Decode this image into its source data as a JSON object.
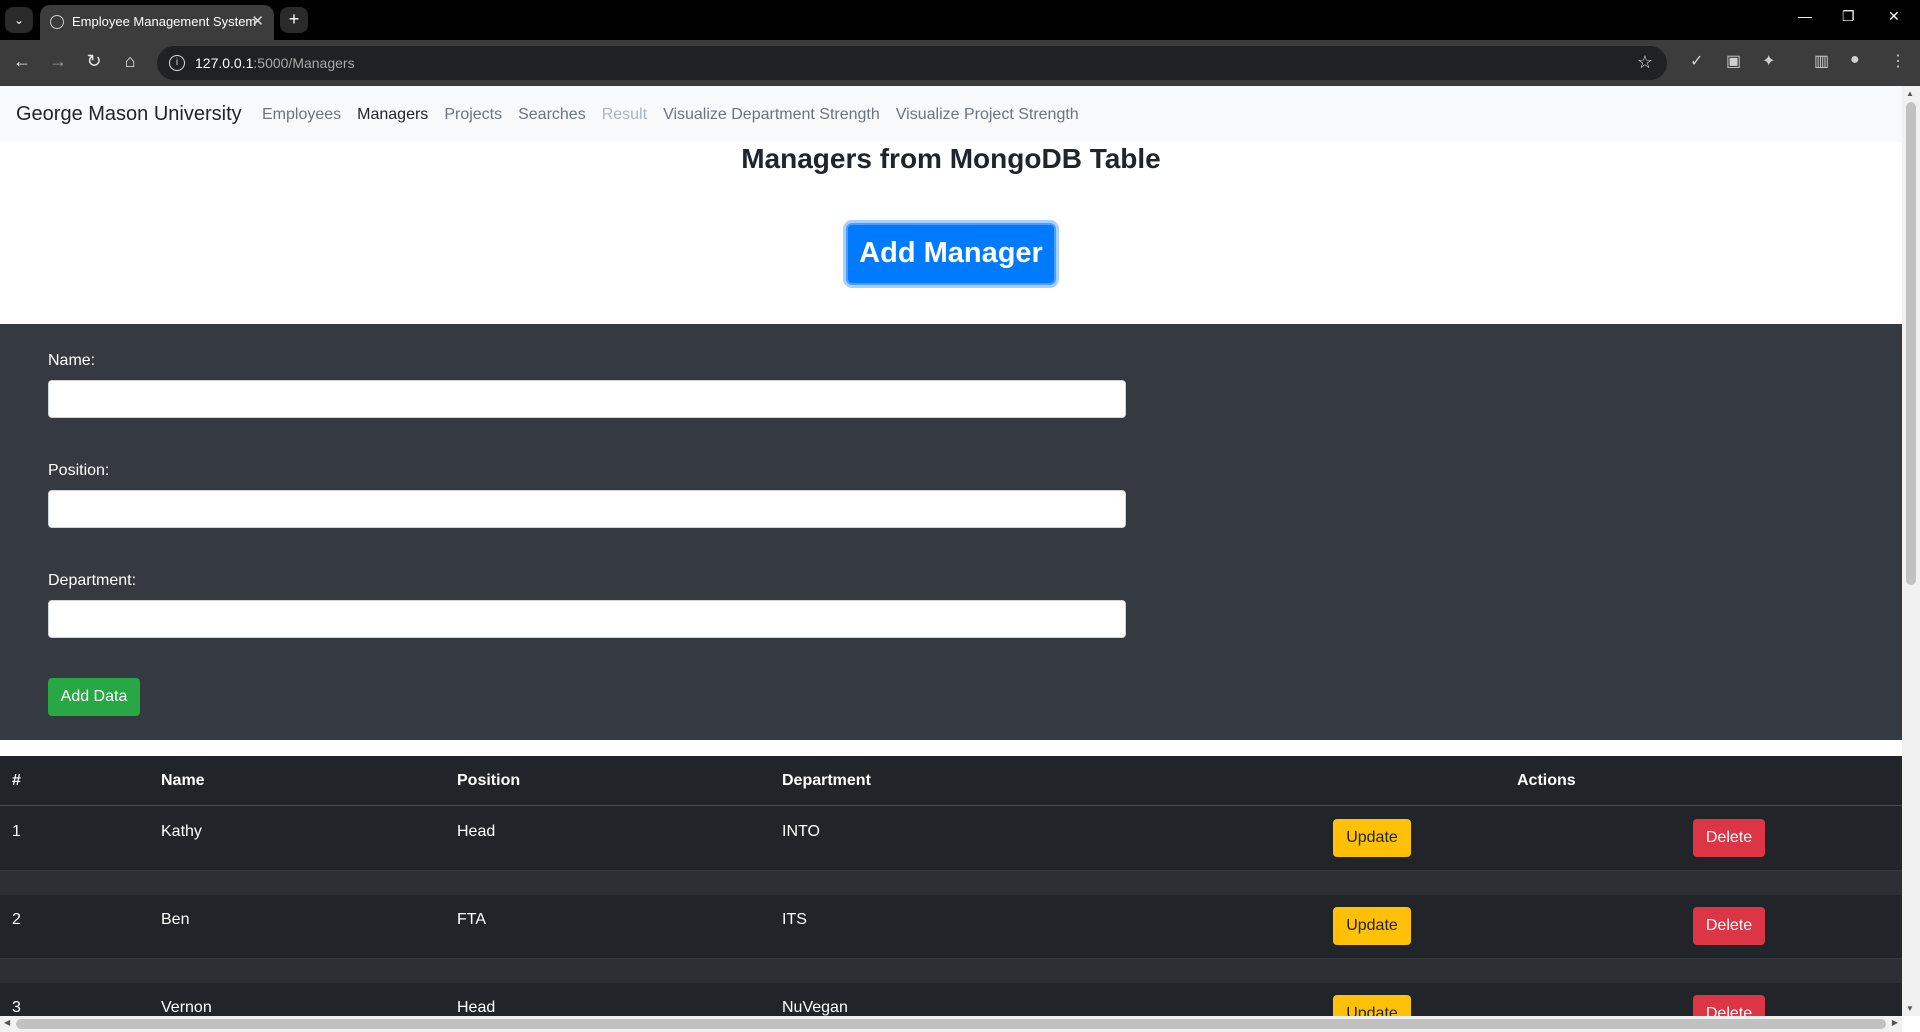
{
  "browser": {
    "tab_title": "Employee Management System",
    "url_host": "127.0.0.1",
    "url_rest": ":5000/Managers"
  },
  "navbar": {
    "brand": "George Mason University",
    "links": [
      {
        "label": "Employees",
        "state": "normal"
      },
      {
        "label": "Managers",
        "state": "active"
      },
      {
        "label": "Projects",
        "state": "normal"
      },
      {
        "label": "Searches",
        "state": "normal"
      },
      {
        "label": "Result",
        "state": "disabled"
      },
      {
        "label": "Visualize Department Strength",
        "state": "normal"
      },
      {
        "label": "Visualize Project Strength",
        "state": "normal"
      }
    ]
  },
  "main": {
    "heading": "Managers from MongoDB Table",
    "add_button": "Add Manager"
  },
  "form": {
    "name_label": "Name:",
    "name_value": "",
    "position_label": "Position:",
    "position_value": "",
    "department_label": "Department:",
    "department_value": "",
    "submit_label": "Add Data"
  },
  "table": {
    "headers": {
      "num": "#",
      "name": "Name",
      "position": "Position",
      "department": "Department",
      "actions": "Actions"
    },
    "rows": [
      {
        "num": "1",
        "name": "Kathy",
        "position": "Head",
        "department": "INTO",
        "update": "Update",
        "delete": "Delete"
      },
      {
        "num": "2",
        "name": "Ben",
        "position": "FTA",
        "department": "ITS",
        "update": "Update",
        "delete": "Delete"
      },
      {
        "num": "3",
        "name": "Vernon",
        "position": "Head",
        "department": "NuVegan",
        "update": "Update",
        "delete": "Delete"
      }
    ]
  },
  "colors": {
    "primary": "#007bff",
    "success": "#28a745",
    "warning": "#ffc107",
    "danger": "#dc3545",
    "dark": "#343a40",
    "table_dark": "#212529"
  }
}
